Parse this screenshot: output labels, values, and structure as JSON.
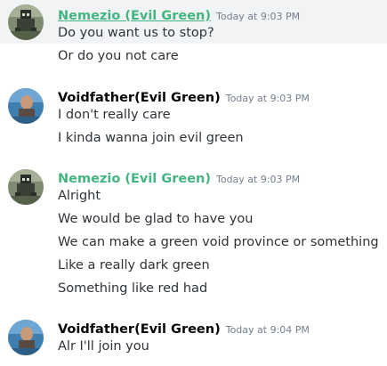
{
  "messages": [
    {
      "author": "Nemezio (Evil Green)",
      "author_color": "#43b581",
      "timestamp": "Today at 9:03 PM",
      "avatar": "pixel-art-avatar",
      "lines": [
        "Do you want us to stop?",
        "Or do you not care"
      ]
    },
    {
      "author": "Voidfather(Evil Green)",
      "author_color": "#060607",
      "timestamp": "Today at 9:03 PM",
      "avatar": "photo-avatar",
      "lines": [
        "I don't really care",
        "I kinda wanna join evil green"
      ]
    },
    {
      "author": "Nemezio (Evil Green)",
      "author_color": "#43b581",
      "timestamp": "Today at 9:03 PM",
      "avatar": "pixel-art-avatar",
      "lines": [
        "Alright",
        "We would be glad to have you",
        "We can make a green void province or something",
        "Like a really dark green",
        "Something like red had"
      ]
    },
    {
      "author": "Voidfather(Evil Green)",
      "author_color": "#060607",
      "timestamp": "Today at 9:04 PM",
      "avatar": "photo-avatar",
      "lines": [
        "Alr I'll join you"
      ]
    }
  ]
}
